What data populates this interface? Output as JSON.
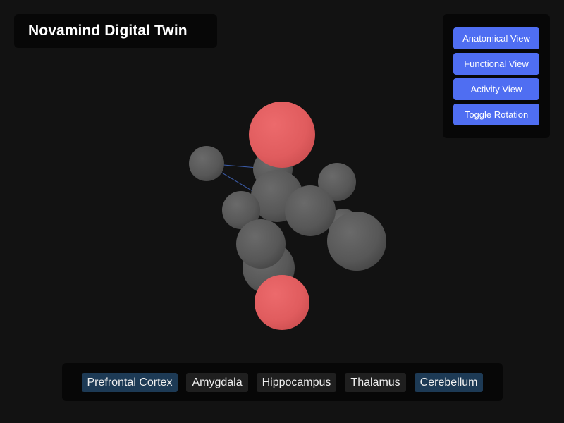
{
  "app": {
    "title": "Novamind Digital Twin"
  },
  "controls": {
    "buttons": [
      {
        "label": "Anatomical View"
      },
      {
        "label": "Functional View"
      },
      {
        "label": "Activity View"
      },
      {
        "label": "Toggle Rotation"
      }
    ],
    "button_color": "#4f6ef2"
  },
  "scene": {
    "node_color_active": "#e35f61",
    "node_color_inactive": "#5a5a5a",
    "connection_colors": [
      "#3d5fb0",
      "#b06a5a"
    ]
  },
  "regions": [
    {
      "label": "Prefrontal Cortex",
      "highlighted": true
    },
    {
      "label": "Amygdala",
      "highlighted": false
    },
    {
      "label": "Hippocampus",
      "highlighted": false
    },
    {
      "label": "Thalamus",
      "highlighted": false
    },
    {
      "label": "Cerebellum",
      "highlighted": true
    }
  ]
}
